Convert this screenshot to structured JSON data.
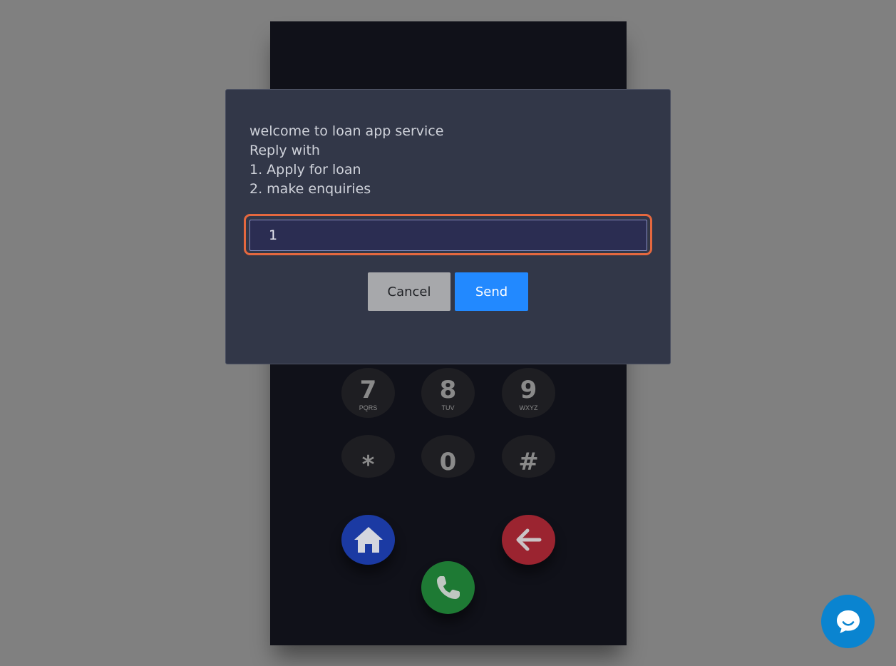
{
  "dialog": {
    "message_lines": [
      "welcome to loan app service",
      "Reply with",
      "1. Apply for loan",
      "2. make enquiries"
    ],
    "input_value": "1",
    "cancel_label": "Cancel",
    "send_label": "Send"
  },
  "keypad": {
    "keys": [
      {
        "digit": "7",
        "letters": "PQRS"
      },
      {
        "digit": "8",
        "letters": "TUV"
      },
      {
        "digit": "9",
        "letters": "WXYZ"
      },
      {
        "digit": "*",
        "letters": ""
      },
      {
        "digit": "0",
        "letters": ""
      },
      {
        "digit": "#",
        "letters": ""
      }
    ]
  },
  "actions": {
    "home_icon": "home-icon",
    "call_icon": "phone-icon",
    "back_icon": "arrow-left-icon"
  },
  "colors": {
    "send_button": "#2289ff",
    "focus_ring": "#e5683f",
    "home_button": "#1b3aa3",
    "call_button": "#1e7a34",
    "back_button": "#9b2430",
    "chat_widget": "#0a84d0"
  }
}
